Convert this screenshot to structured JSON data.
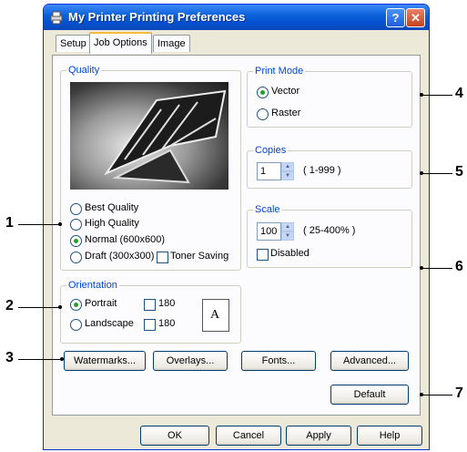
{
  "window": {
    "title": "My Printer Printing Preferences",
    "help_glyph": "?",
    "close_glyph": "✕"
  },
  "tabs": [
    {
      "label": "Setup"
    },
    {
      "label": "Job Options",
      "active": true
    },
    {
      "label": "Image"
    }
  ],
  "quality": {
    "label": "Quality",
    "options": [
      {
        "label": "Best Quality",
        "selected": false
      },
      {
        "label": "High Quality",
        "selected": false
      },
      {
        "label": "Normal (600x600)",
        "selected": true
      },
      {
        "label": "Draft (300x300)",
        "selected": false
      }
    ],
    "toner_saving": {
      "label": "Toner Saving",
      "checked": false
    }
  },
  "orientation": {
    "label": "Orientation",
    "portrait": {
      "label": "Portrait",
      "selected": true
    },
    "landscape": {
      "label": "Landscape",
      "selected": false
    },
    "rotate_portrait": {
      "label": "180",
      "checked": false
    },
    "rotate_landscape": {
      "label": "180",
      "checked": false
    },
    "page_glyph": "A"
  },
  "print_mode": {
    "label": "Print Mode",
    "vector": {
      "label": "Vector",
      "selected": true
    },
    "raster": {
      "label": "Raster",
      "selected": false
    }
  },
  "copies": {
    "label": "Copies",
    "value": "1",
    "range": "( 1-999 )"
  },
  "scale": {
    "label": "Scale",
    "value": "100",
    "range": "( 25-400% )",
    "disabled": {
      "label": "Disabled",
      "checked": false
    }
  },
  "buttons": {
    "watermarks": "Watermarks...",
    "overlays": "Overlays...",
    "fonts": "Fonts...",
    "advanced": "Advanced...",
    "default": "Default",
    "ok": "OK",
    "cancel": "Cancel",
    "apply": "Apply",
    "help": "Help"
  },
  "callouts": [
    "1",
    "2",
    "3",
    "4",
    "5",
    "6",
    "7"
  ],
  "colors": {
    "title_bar": "#0a5fd8",
    "group_label": "#0046d5",
    "radio_selected": "#21a121"
  }
}
